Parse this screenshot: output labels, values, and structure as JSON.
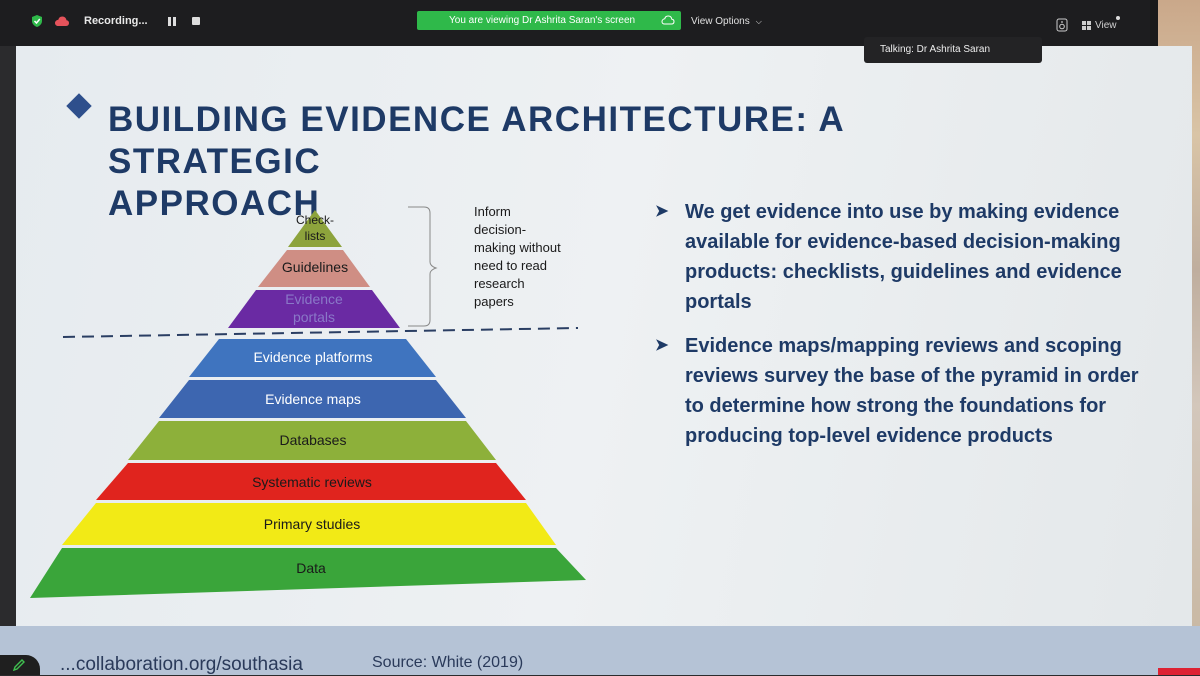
{
  "toolbar": {
    "recording_label": "Recording...",
    "share_banner": "You are viewing Dr Ashrita Saran's screen",
    "view_options": "View Options",
    "view_label": "View",
    "talking": "Talking: Dr Ashrita Saran"
  },
  "slide": {
    "title_line1": "BUILDING EVIDENCE ARCHITECTURE: A STRATEGIC",
    "title_line2": "APPROACH",
    "pyramid": {
      "top_levels": [
        {
          "label_line1": "Check-",
          "label_line2": "lists",
          "color": "#8da33c"
        },
        {
          "label_line1": "Guidelines",
          "label_line2": "",
          "color": "#cf8e84"
        },
        {
          "label_line1": "Evidence",
          "label_line2": "portals",
          "color": "#6a2aa3"
        }
      ],
      "base_levels": [
        {
          "label": "Evidence platforms",
          "color": "#3f74bf"
        },
        {
          "label": "Evidence maps",
          "color": "#3d66b0"
        },
        {
          "label": "Databases",
          "color": "#8db03a"
        },
        {
          "label": "Systematic reviews",
          "color": "#e0241e"
        },
        {
          "label": "Primary studies",
          "color": "#f2ea16"
        },
        {
          "label": "Data",
          "color": "#3aa53a"
        }
      ]
    },
    "inform_note": [
      "Inform",
      "decision-",
      "making without",
      "need to read",
      "research",
      "papers"
    ],
    "bullets": [
      "We get evidence into use by making evidence available for evidence-based decision-making products: checklists, guidelines and evidence portals",
      "Evidence maps/mapping reviews and scoping reviews survey the base of the pyramid in order to determine how strong the foundations for producing top-level evidence products"
    ],
    "footer_url": "...collaboration.org/southasia",
    "footer_source": "Source: White (2019)"
  }
}
